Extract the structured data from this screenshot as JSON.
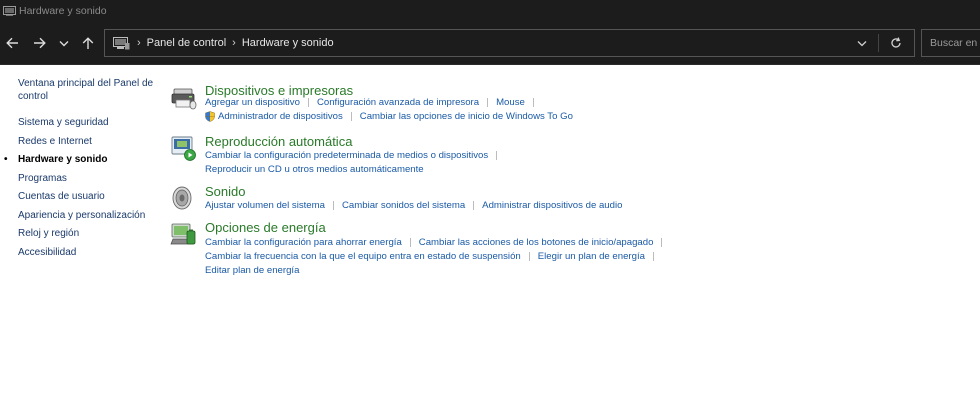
{
  "window": {
    "title": "Hardware y sonido"
  },
  "nav": {
    "breadcrumbs": [
      "Panel de control",
      "Hardware y sonido"
    ],
    "search_placeholder": "Buscar en el Panel de control"
  },
  "sidebar": {
    "items": [
      {
        "label": "Ventana principal del Panel de control"
      },
      {
        "label": "Sistema y seguridad"
      },
      {
        "label": "Redes e Internet"
      },
      {
        "label": "Hardware y sonido",
        "current": true
      },
      {
        "label": "Programas"
      },
      {
        "label": "Cuentas de usuario"
      },
      {
        "label": "Apariencia y personalización"
      },
      {
        "label": "Reloj y región"
      },
      {
        "label": "Accesibilidad"
      }
    ]
  },
  "categories": [
    {
      "title": "Dispositivos e impresoras",
      "icon": "devices-printers-icon",
      "rows": [
        [
          "Agregar un dispositivo",
          "Configuración avanzada de impresora",
          "Mouse"
        ],
        [
          "Administrador de dispositivos",
          "Cambiar las opciones de inicio de Windows To Go"
        ]
      ]
    },
    {
      "title": "Reproducción automática",
      "icon": "autoplay-icon",
      "rows": [
        [
          "Cambiar la configuración predeterminada de medios o dispositivos"
        ],
        [
          "Reproducir un CD u otros medios automáticamente"
        ]
      ]
    },
    {
      "title": "Sonido",
      "icon": "speaker-icon",
      "rows": [
        [
          "Ajustar volumen del sistema",
          "Cambiar sonidos del sistema",
          "Administrar dispositivos de audio"
        ]
      ]
    },
    {
      "title": "Opciones de energía",
      "icon": "power-options-icon",
      "rows": [
        [
          "Cambiar la configuración para ahorrar energía",
          "Cambiar las acciones de los botones de inicio/apagado"
        ],
        [
          "Cambiar la frecuencia con la que el equipo entra en estado de suspensión",
          "Elegir un plan de energía"
        ],
        [
          "Editar plan de energía"
        ]
      ]
    }
  ],
  "colors": {
    "chrome_bg": "#1c1c1c",
    "category_title": "#2a7a2a",
    "link": "#1a5aa6",
    "sidebar_link": "#1a3a6b"
  }
}
